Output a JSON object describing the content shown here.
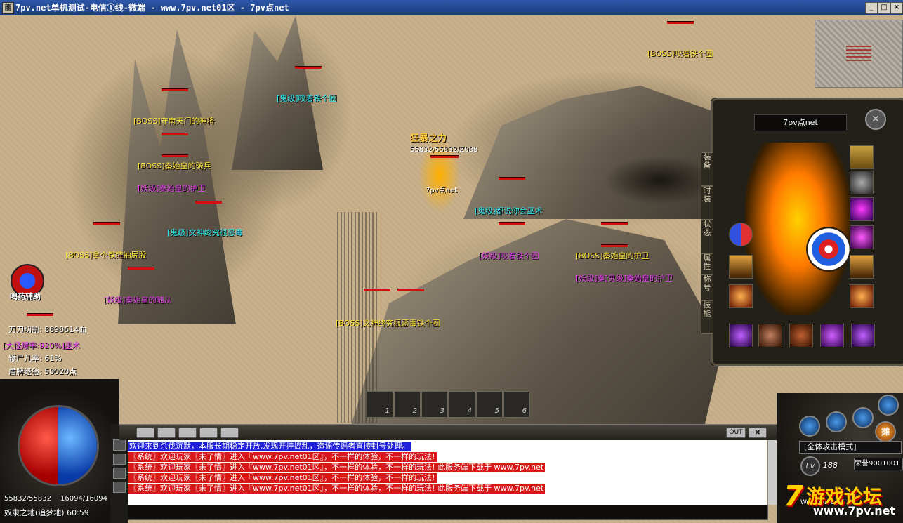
{
  "window": {
    "title": "7pv.net单机测试-电信①线-微端 - www.7pv.net01区 - 7pv点net",
    "controls": [
      "_",
      "□",
      "×"
    ]
  },
  "world": {
    "player": {
      "name": "7pv点net",
      "hp_text": "55832/55832/Z088",
      "title_badge": "狂暴之力"
    },
    "monsters": [
      {
        "label": "[BOSS]咬着铁个圈",
        "color": "yellow"
      },
      {
        "label": "[鬼级]咬着铁个圈",
        "color": "cyan"
      },
      {
        "label": "[BOSS]守南天门的神将",
        "color": "yellow"
      },
      {
        "label": "[BOSS]秦始皇的骑兵",
        "color": "yellow"
      },
      {
        "label": "[妖级]秦始皇的护卫",
        "color": "magenta"
      },
      {
        "label": "[鬼级]文神终究很恶毒",
        "color": "cyan"
      },
      {
        "label": "[BOSS]拿个铁链抽尻股",
        "color": "yellow"
      },
      {
        "label": "[妖级]秦始皇的随从",
        "color": "magenta"
      },
      {
        "label": "[鬼级]都说你会巫术",
        "color": "cyan"
      },
      {
        "label": "[妖级]咬着铁个圈",
        "color": "magenta"
      },
      {
        "label": "[BOSS]秦始皇的护卫",
        "color": "yellow"
      },
      {
        "label": "[妖级]秦[鬼级]秦始皇的护卫",
        "color": "magenta"
      },
      {
        "label": "[BOSS]文神终究很恶毒铁个圈",
        "color": "yellow"
      }
    ]
  },
  "stats": {
    "assist_button": "喝药辅助",
    "lines": [
      "刀刀切割: 8898614血",
      "[大怪爆率:920%]巫术",
      "鞭尸几率: 61%",
      "盾牌经验: 50020点"
    ],
    "hp_mp": "55832/55832",
    "mp2": "16094/16094",
    "location": "奴隶之地(追梦地) 60:59"
  },
  "skill_slots": [
    "1",
    "2",
    "3",
    "4",
    "5",
    "6"
  ],
  "chat": {
    "out_button": "OUT",
    "messages": [
      {
        "text": "欢迎来到杀伐沉默，本服长期稳定开放,发现开挂捣乱，造谣传谣者直接封号处理。",
        "bg": "#2020d8"
      },
      {
        "text": "〖系统〗欢迎玩家〖未了情〗进入『www.7pv.net01区』，不一样的体验，不一样的玩法!",
        "bg": "#d81818"
      },
      {
        "text": "〖系统〗欢迎玩家〖未了情〗进入『www.7pv.net01区』，不一样的体验，不一样的玩法! 此服务端下载于 www.7pv.net",
        "bg": "#d81818"
      },
      {
        "text": "〖系统〗欢迎玩家〖未了情〗进入『www.7pv.net01区』，不一样的体验，不一样的玩法!",
        "bg": "#d81818"
      },
      {
        "text": "〖系统〗欢迎玩家〖未了情〗进入『www.7pv.net01区』，不一样的体验，不一样的玩法! 此服务端下载于 www.7pv.net",
        "bg": "#d81818"
      }
    ]
  },
  "right_panel": {
    "attack_mode": "[全体攻击模式]",
    "level_label": "Lv",
    "level_value": "188",
    "honor": "荣誉9001001",
    "time": "Wed 09:58:55",
    "stall_button": "摊"
  },
  "equip_panel": {
    "char_name": "7pv点net",
    "tabs": [
      "装备",
      "时装",
      "状态",
      "属性",
      "称号",
      "技能"
    ]
  },
  "brand": {
    "main": "游戏论坛",
    "digit": "7",
    "url": "www.7pv.net"
  },
  "colors": {
    "yellow": "#ffe23a",
    "cyan": "#2ce6f0",
    "magenta": "#e040e8",
    "hpbar": "#d21010"
  }
}
